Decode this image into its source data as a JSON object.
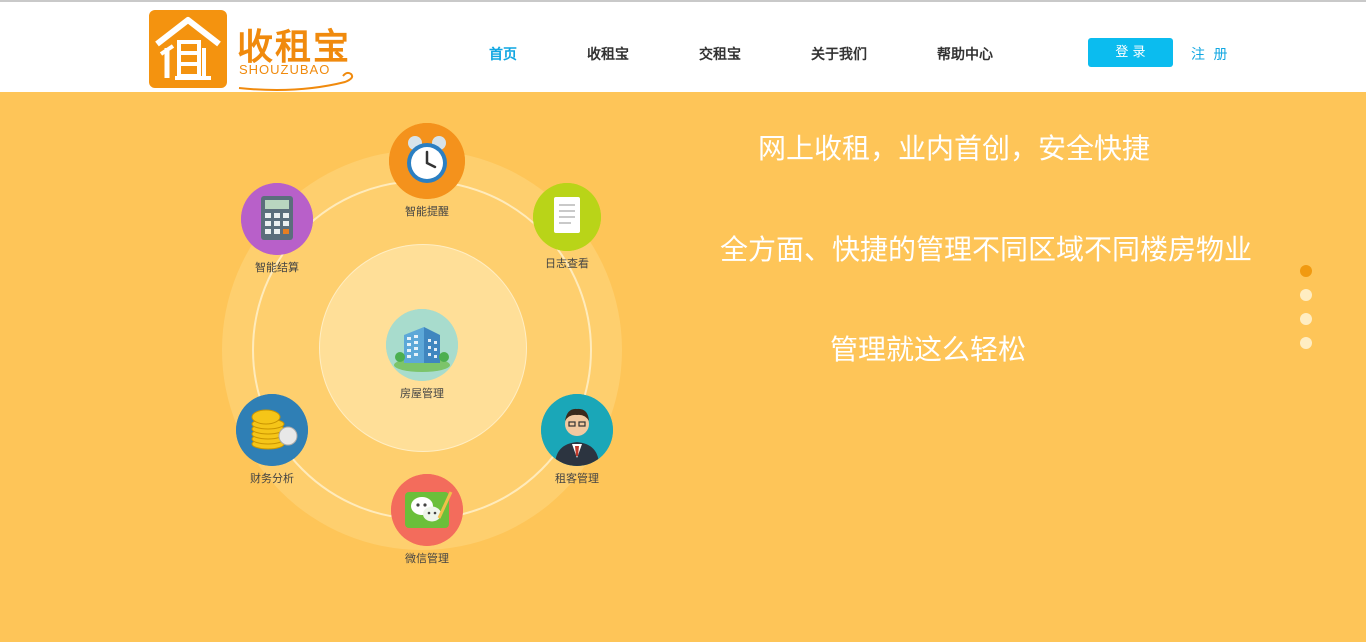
{
  "brand": {
    "name_cn": "收租宝",
    "name_en": "SHOUZUBAO",
    "logo_color": "#f4930f"
  },
  "nav": {
    "items": [
      {
        "label": "首页",
        "active": true
      },
      {
        "label": "收租宝",
        "active": false
      },
      {
        "label": "交租宝",
        "active": false
      },
      {
        "label": "关于我们",
        "active": false
      },
      {
        "label": "帮助中心",
        "active": false
      }
    ],
    "login_label": "登 录",
    "register_label": "注 册"
  },
  "banner": {
    "background": "#fec558",
    "center_feature": {
      "label": "房屋管理",
      "icon": "building-icon"
    },
    "features": [
      {
        "label": "智能提醒",
        "icon": "alarm-clock-icon",
        "color": "#f4921c"
      },
      {
        "label": "日志查看",
        "icon": "notepad-icon",
        "color": "#b9d418"
      },
      {
        "label": "租客管理",
        "icon": "businessman-icon",
        "color": "#1aa7b8"
      },
      {
        "label": "微信管理",
        "icon": "wechat-icon",
        "color": "#f36c5c"
      },
      {
        "label": "财务分析",
        "icon": "coins-icon",
        "color": "#2f7fb5"
      },
      {
        "label": "智能结算",
        "icon": "calculator-icon",
        "color": "#b860c9"
      }
    ],
    "taglines": [
      "网上收租，业内首创，安全快捷",
      "全方面、快捷的管理不同区域不同楼房物业",
      "管理就这么轻松"
    ],
    "slider_dots": [
      true,
      false,
      false,
      false
    ]
  }
}
